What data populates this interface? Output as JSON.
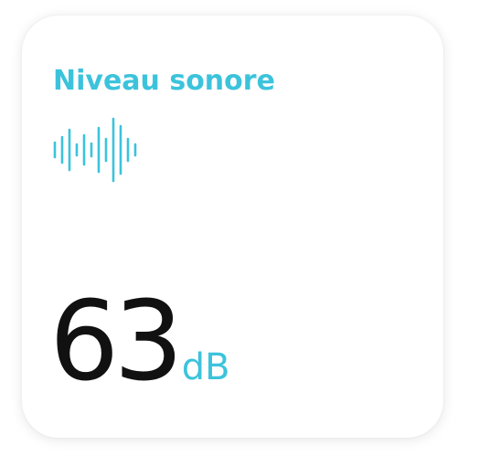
{
  "card": {
    "title": "Niveau sonore",
    "icon": "sound-wave-icon",
    "value": "63",
    "unit": "dB"
  },
  "colors": {
    "accent": "#3cc3dc",
    "value_text": "#111111",
    "background": "#ffffff"
  }
}
